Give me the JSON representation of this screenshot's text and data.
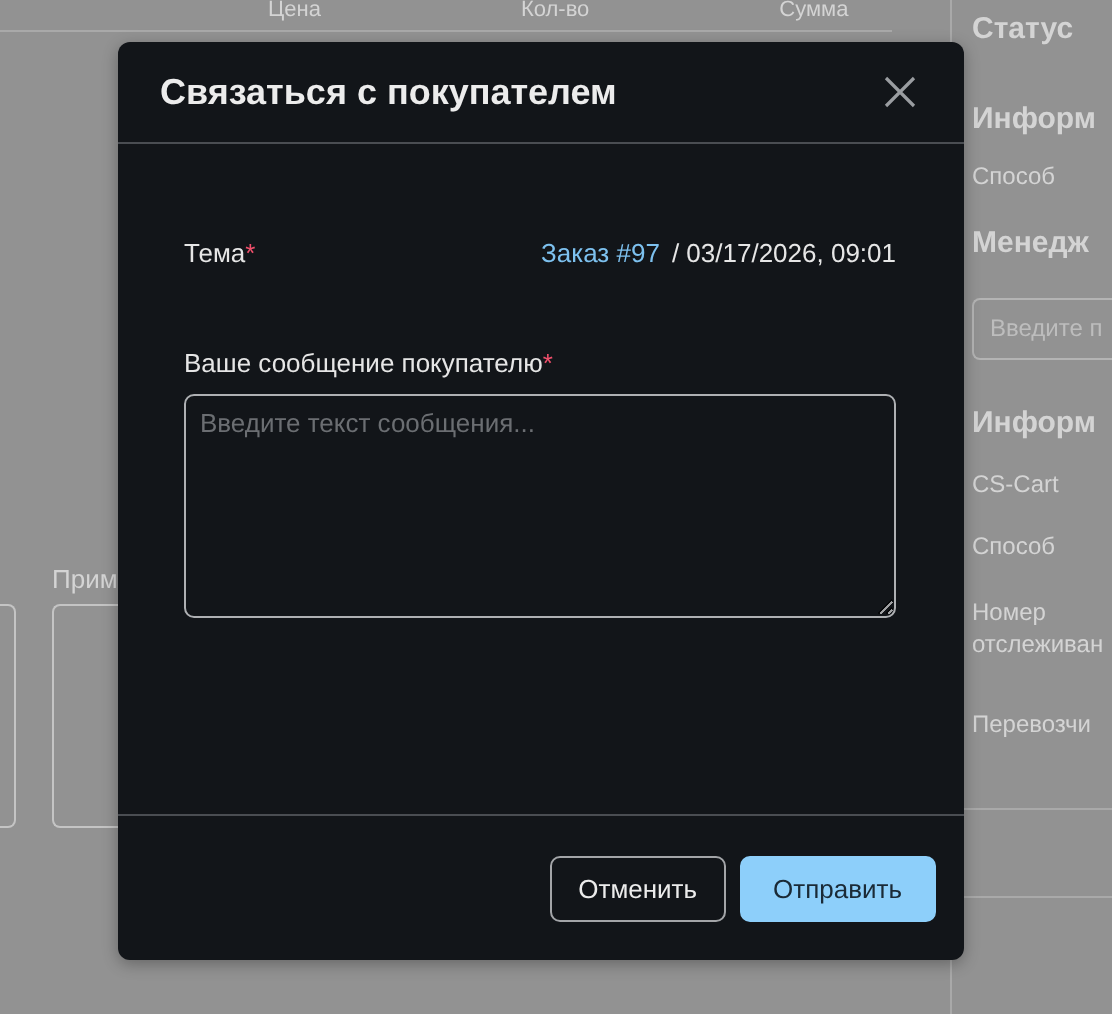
{
  "background": {
    "table_columns": [
      "Цена",
      "Кол-во",
      "Сумма"
    ],
    "notes_label": "Прим",
    "sidebar": [
      {
        "kind": "heading",
        "text": "Статус"
      },
      {
        "kind": "heading",
        "text": "Информ"
      },
      {
        "kind": "text",
        "text": "Способ"
      },
      {
        "kind": "heading",
        "text": "Менедж"
      },
      {
        "kind": "field",
        "placeholder": "Введите п"
      },
      {
        "kind": "heading",
        "text": "Информ"
      },
      {
        "kind": "text",
        "text": "CS-Cart"
      },
      {
        "kind": "text",
        "text": "Способ"
      },
      {
        "kind": "text",
        "text": "Номер отслеживан"
      },
      {
        "kind": "text",
        "text": "Перевозчи"
      }
    ]
  },
  "dialog": {
    "title": "Связаться с покупателем",
    "subject": {
      "label": "Тема",
      "required_mark": "*",
      "link": "Заказ #97",
      "text": "/ 03/17/2026, 09:01"
    },
    "message": {
      "label": "Ваше сообщение покупателю",
      "required_mark": "*",
      "placeholder": "Введите текст сообщения..."
    },
    "buttons": [
      {
        "label": "Отменить",
        "kind": "secondary"
      },
      {
        "label": "Отправить",
        "kind": "primary"
      }
    ]
  }
}
